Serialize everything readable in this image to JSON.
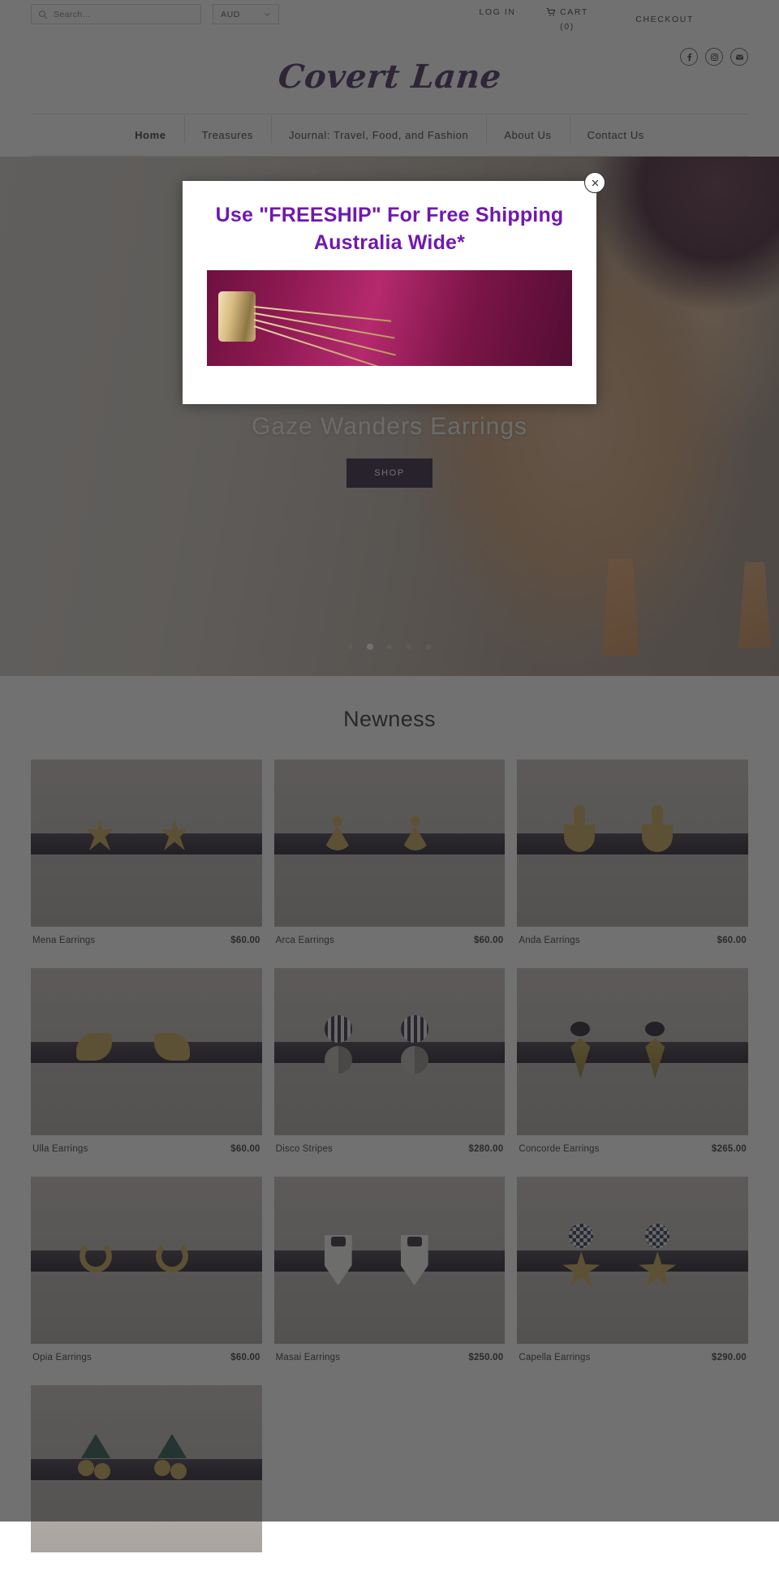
{
  "utility": {
    "search_placeholder": "Search...",
    "currency": "AUD",
    "login_label": "LOG IN",
    "cart_label": "CART",
    "cart_count": "(0)",
    "checkout_label": "CHECKOUT",
    "social": [
      "facebook-icon",
      "instagram-icon",
      "email-icon"
    ]
  },
  "brand": {
    "logo_text": "Covert Lane"
  },
  "nav": {
    "items": [
      {
        "label": "Home",
        "active": true
      },
      {
        "label": "Treasures",
        "active": false
      },
      {
        "label": "Journal: Travel, Food, and Fashion",
        "active": false
      },
      {
        "label": "About Us",
        "active": false
      },
      {
        "label": "Contact Us",
        "active": false
      }
    ]
  },
  "hero": {
    "caption": "Gaze Wanders Earrings",
    "button_label": "SHOP",
    "slide_count": 5,
    "active_slide": 1
  },
  "newness": {
    "title": "Newness",
    "products": [
      {
        "name": "Mena Earrings",
        "price": "$60.00"
      },
      {
        "name": "Arca Earrings",
        "price": "$60.00"
      },
      {
        "name": "Anda Earrings",
        "price": "$60.00"
      },
      {
        "name": "Ulla Earrings",
        "price": "$60.00"
      },
      {
        "name": "Disco Stripes",
        "price": "$280.00"
      },
      {
        "name": "Concorde Earrings",
        "price": "$265.00"
      },
      {
        "name": "Opia Earrings",
        "price": "$60.00"
      },
      {
        "name": "Masai Earrings",
        "price": "$250.00"
      },
      {
        "name": "Capella Earrings",
        "price": "$290.00"
      },
      {
        "name": "",
        "price": ""
      }
    ]
  },
  "modal": {
    "title": "Use \"FREESHIP\" For Free Shipping Australia Wide*",
    "close_icon": "close-icon"
  },
  "colors": {
    "brand_purple": "#3d2356",
    "promo_purple": "#7018b0",
    "hero_button": "#2b1a36"
  }
}
